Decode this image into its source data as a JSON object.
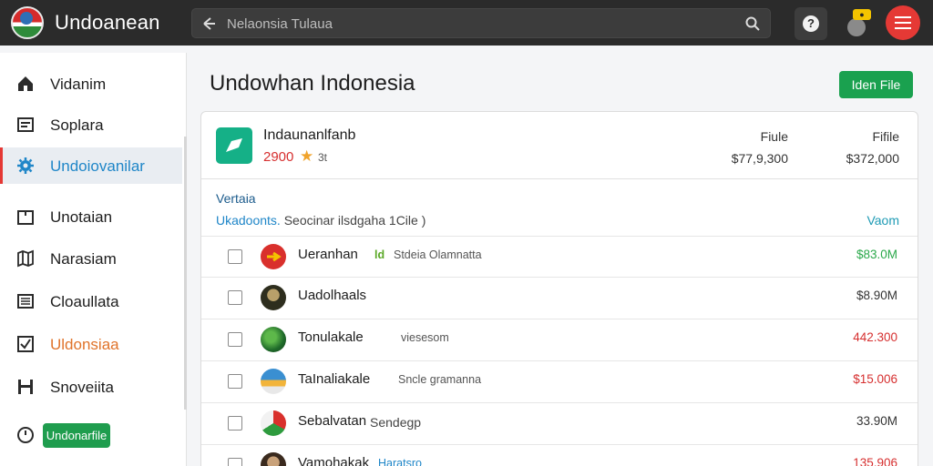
{
  "app": {
    "title": "Undoanean"
  },
  "search": {
    "placeholder": "Nelaonsia Tulaua"
  },
  "header": {
    "notification_badge": "●"
  },
  "sidebar": {
    "items": [
      {
        "label": "Vidanim",
        "icon": "home-icon",
        "state": "normal"
      },
      {
        "label": "Soplara",
        "icon": "list-icon",
        "state": "normal"
      },
      {
        "label": "Undoiovanilar",
        "icon": "gear-icon",
        "state": "active"
      },
      {
        "label": "Unotaian",
        "icon": "box-icon",
        "state": "normal"
      },
      {
        "label": "Narasiam",
        "icon": "map-icon",
        "state": "normal"
      },
      {
        "label": "Cloaullata",
        "icon": "table-icon",
        "state": "normal"
      },
      {
        "label": "Uldonsiaa",
        "icon": "checkbox-icon",
        "state": "highlight"
      },
      {
        "label": "Snoveiita",
        "icon": "save-icon",
        "state": "normal"
      }
    ],
    "cta_label": "Undonarfile"
  },
  "main": {
    "title": "Undowhan Indonesia",
    "new_file_label": "Iden File"
  },
  "card": {
    "name": "Indaunanlfanb",
    "rating": "2900",
    "rating_extra": "3t",
    "stats": [
      {
        "heading": "Fiule",
        "value": "$77,9,300"
      },
      {
        "heading": "Fifile",
        "value": "$372,000"
      }
    ],
    "section_title": "Vertaia",
    "section_sub_highlight": "Ukadoonts.",
    "section_sub_rest": "Seocinar ilsdgaha 1Cile )",
    "section_right": "Vaom"
  },
  "rows": [
    {
      "name": "Ueranhan",
      "tag_green": "ld",
      "tag": "Stdeia Olamnatta",
      "value": "$83.0M",
      "value_color": "#2aa84a"
    },
    {
      "name": "Uadolhaals",
      "tag_green": "",
      "tag": "",
      "value": "$8.90M",
      "value_color": "#333333"
    },
    {
      "name": "Tonulakale",
      "tag_green": "",
      "tag": "viesesom",
      "value": "442.300",
      "value_color": "#d62f2f"
    },
    {
      "name": "TaInaliakale",
      "tag_green": "",
      "tag": "Sncle gramanna",
      "value": "$15.006",
      "value_color": "#d62f2f"
    },
    {
      "name": "Sebalvatan",
      "tag_green": "",
      "tag": "Sendegp",
      "value": "33.90M",
      "value_color": "#333333"
    },
    {
      "name": "Vamohakak",
      "tag_green": "",
      "tag": "Haratsro",
      "value": "135.906",
      "value_color": "#d62f2f"
    }
  ],
  "colors": {
    "accent_red": "#e53935",
    "accent_green": "#1aa14f",
    "link_blue": "#1f86c8"
  }
}
